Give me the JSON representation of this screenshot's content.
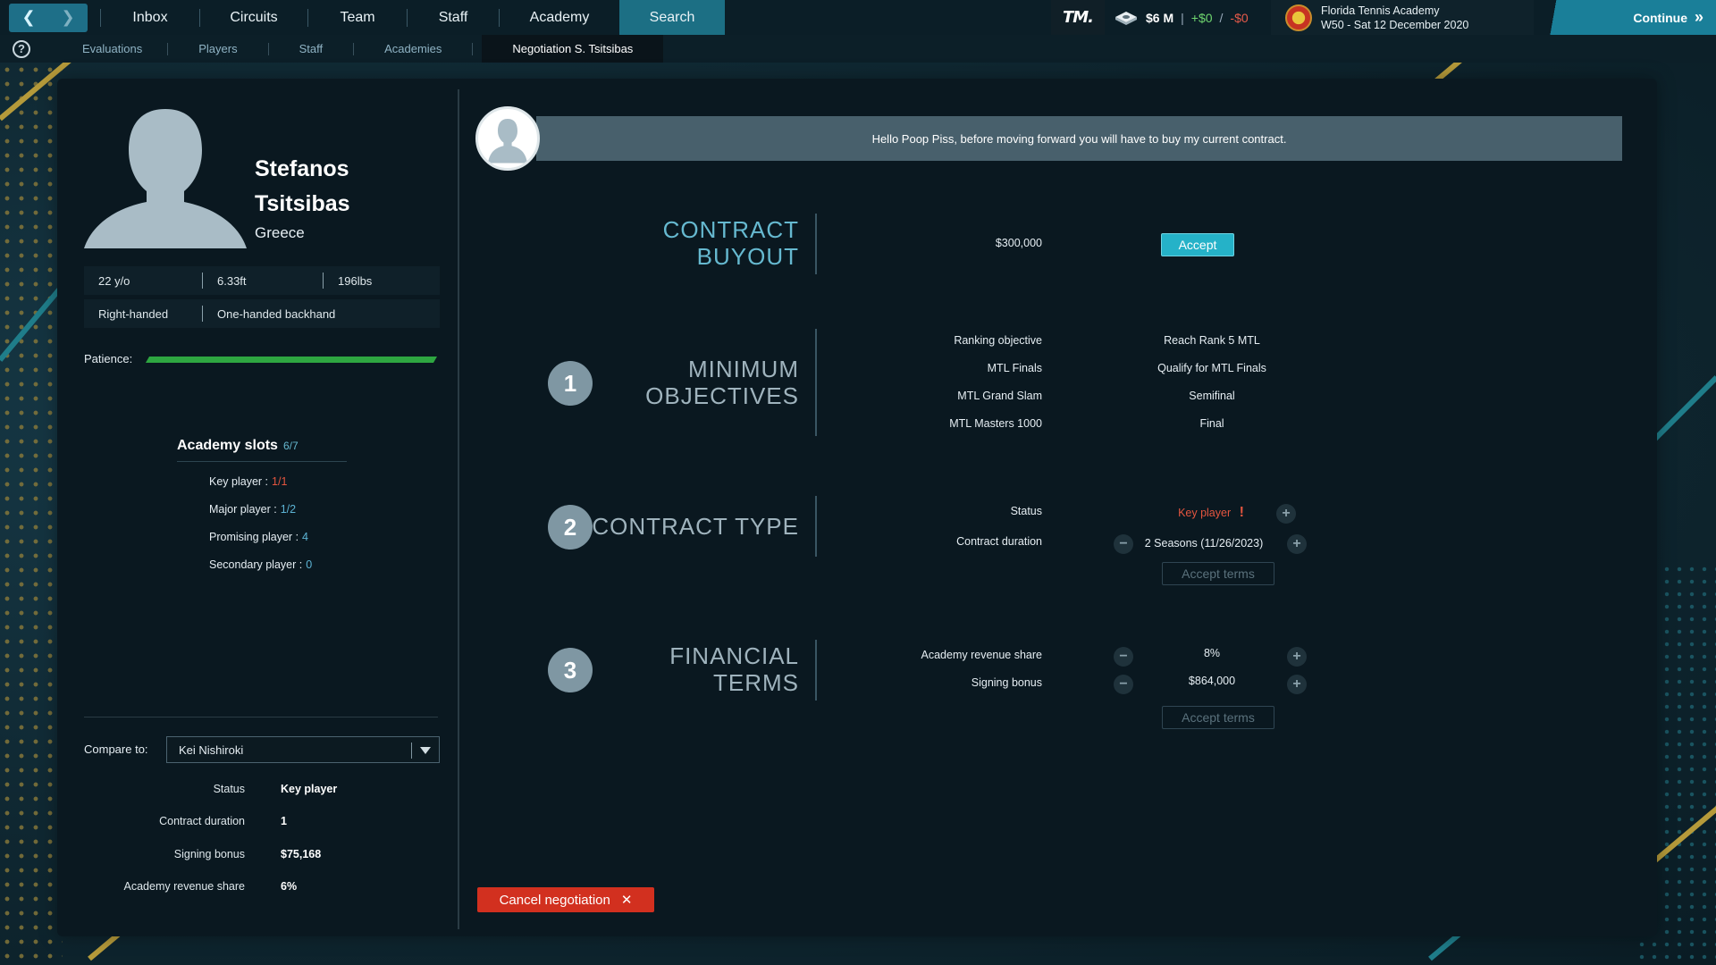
{
  "topbar": {
    "nav": [
      "Inbox",
      "Circuits",
      "Team",
      "Staff",
      "Academy",
      "Search"
    ],
    "active_nav": "Search",
    "logo_text": "TM.",
    "money": {
      "balance": "$6 M",
      "income": "+$0",
      "expense": "-$0",
      "separator": "/"
    },
    "academy_name": "Florida Tennis Academy",
    "date": "W50 - Sat 12 December 2020",
    "continue_label": "Continue"
  },
  "subbar": {
    "items": [
      "Evaluations",
      "Players",
      "Staff",
      "Academies"
    ],
    "active_tab": "Negotiation S. Tsitsibas"
  },
  "player": {
    "first_name": "Stefanos",
    "last_name": "Tsitsibas",
    "country": "Greece",
    "age": "22 y/o",
    "height": "6.33ft",
    "weight": "196lbs",
    "hand": "Right-handed",
    "backhand": "One-handed backhand",
    "patience_label": "Patience:",
    "patience_level": 1.0
  },
  "academy_slots": {
    "title": "Academy slots",
    "count": "6/7",
    "items": [
      {
        "label": "Key player :",
        "value": "1/1"
      },
      {
        "label": "Major player :",
        "value": "1/2"
      },
      {
        "label": "Promising player :",
        "value": "4"
      },
      {
        "label": "Secondary player :",
        "value": "0"
      }
    ]
  },
  "compare": {
    "label": "Compare to:",
    "selected": "Kei Nishiroki",
    "rows": [
      {
        "label": "Status",
        "value": "Key player"
      },
      {
        "label": "Contract duration",
        "value": "1"
      },
      {
        "label": "Signing bonus",
        "value": "$75,168"
      },
      {
        "label": "Academy revenue share",
        "value": "6%"
      }
    ]
  },
  "message": "Hello Poop Piss, before moving forward you will have to buy my current contract.",
  "buyout": {
    "title_line1": "CONTRACT",
    "title_line2": "BUYOUT",
    "amount": "$300,000",
    "accept_label": "Accept"
  },
  "objectives": {
    "number": "1",
    "title_line1": "MINIMUM",
    "title_line2": "OBJECTIVES",
    "rows": [
      {
        "label": "Ranking objective",
        "value": "Reach Rank 5 MTL"
      },
      {
        "label": "MTL Finals",
        "value": "Qualify for MTL Finals"
      },
      {
        "label": "MTL Grand Slam",
        "value": "Semifinal"
      },
      {
        "label": "MTL Masters 1000",
        "value": "Final"
      }
    ]
  },
  "contract_type": {
    "number": "2",
    "title": "CONTRACT TYPE",
    "status_label": "Status",
    "status_value": "Key player",
    "status_alert": "!",
    "duration_label": "Contract duration",
    "duration_value": "2 Seasons (11/26/2023)",
    "accept_terms": "Accept terms"
  },
  "financial": {
    "number": "3",
    "title_line1": "FINANCIAL",
    "title_line2": "TERMS",
    "rows": [
      {
        "label": "Academy revenue share",
        "value": "8%"
      },
      {
        "label": "Signing bonus",
        "value": "$864,000"
      }
    ],
    "accept_terms": "Accept terms"
  },
  "cancel_label": "Cancel negotiation",
  "colors": {
    "accent_teal": "#66b9d0",
    "accept_button": "#25b2c8",
    "cancel_button": "#d2301f",
    "alert_red": "#e4553f",
    "patience_green": "#2ea641"
  },
  "icons": {
    "back": "chevron-left-icon",
    "forward": "chevron-right-icon",
    "help": "help-circle-icon",
    "money": "money-stack-icon",
    "continue": "double-chevron-right-icon",
    "dropdown": "caret-down-icon",
    "cancel": "close-icon"
  }
}
